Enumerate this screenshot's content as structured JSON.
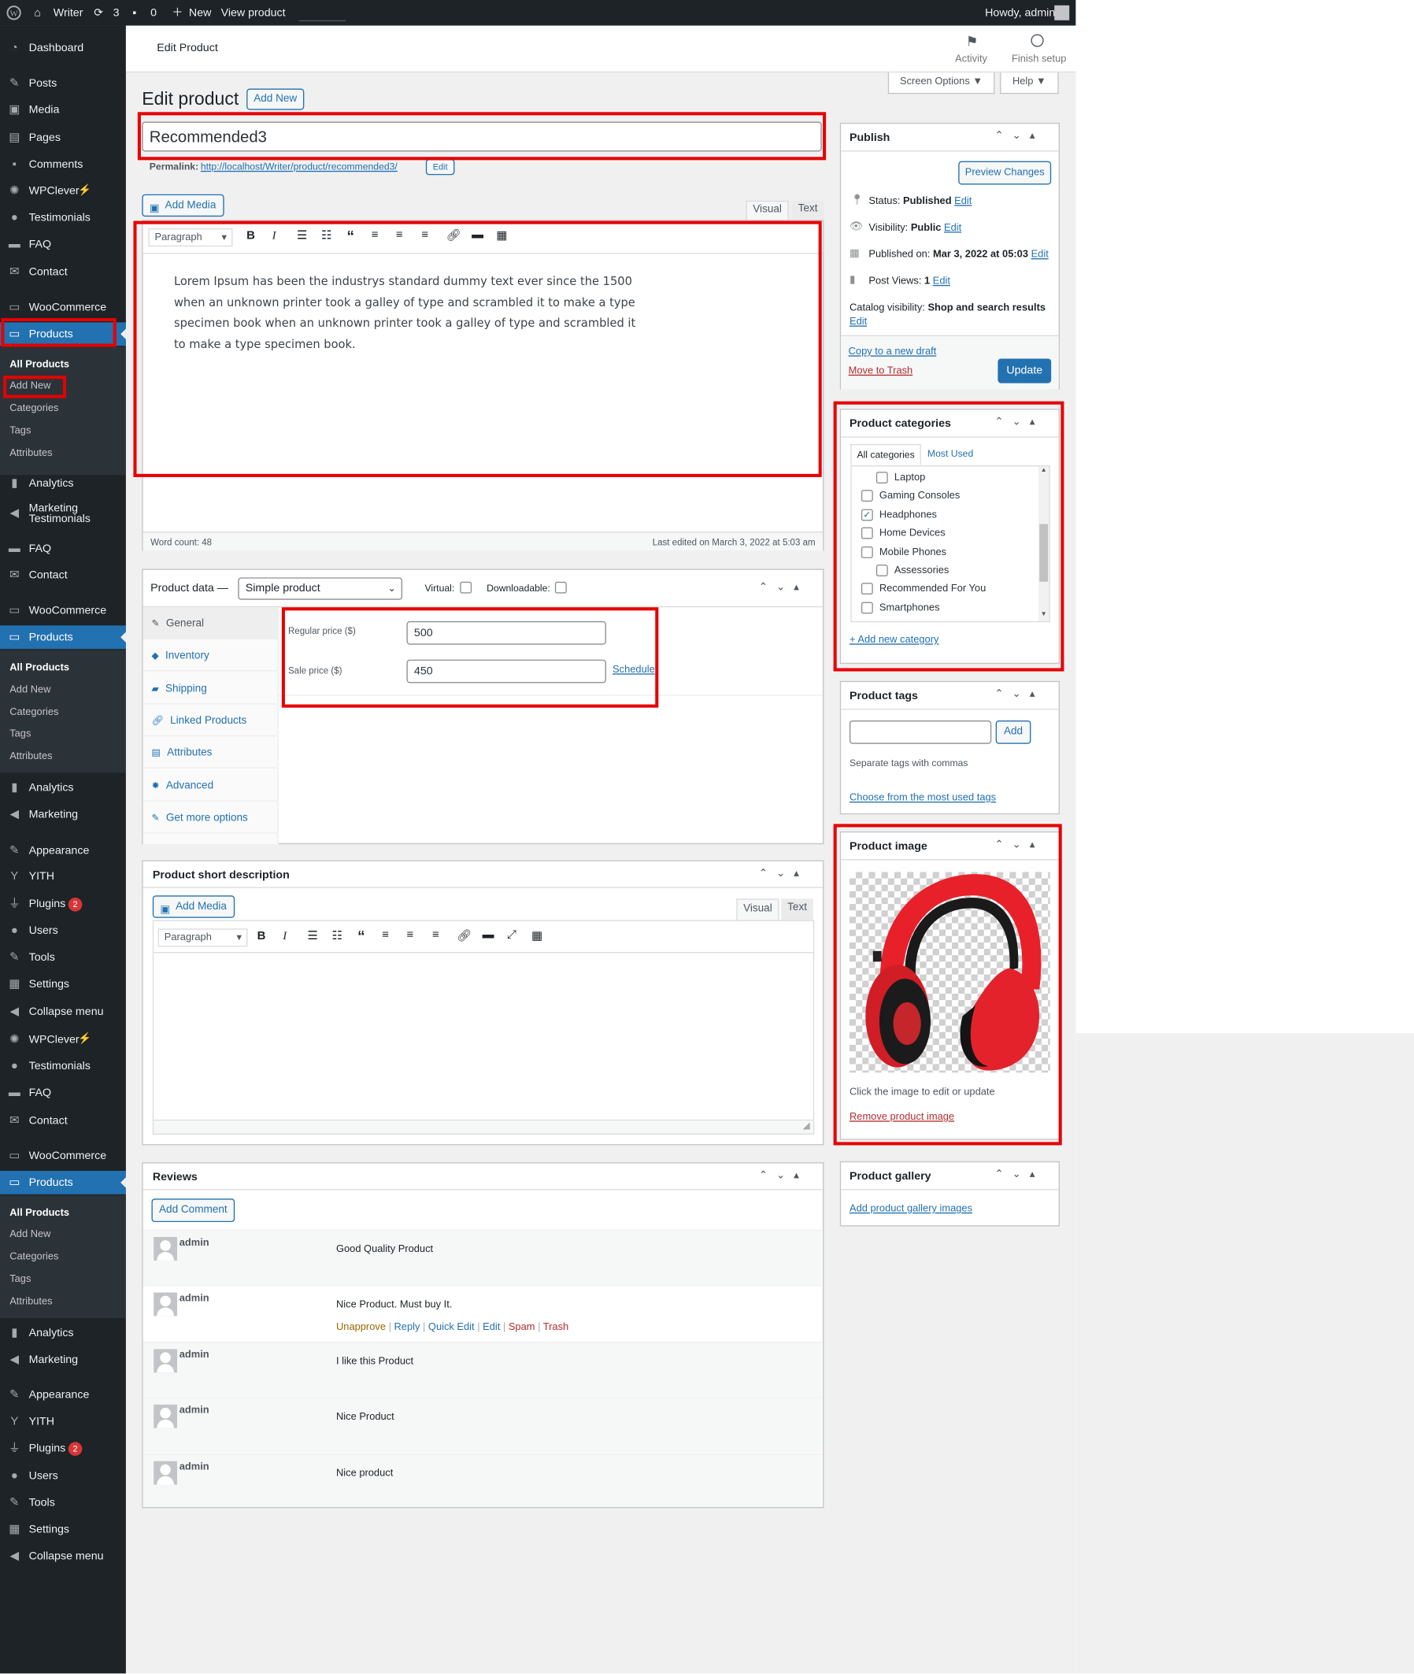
{
  "adminbar": {
    "site": "Writer",
    "updates": "3",
    "comments": "0",
    "new": "New",
    "view": "View product",
    "howdy": "Howdy, admin"
  },
  "colors": {
    "accent": "#2271b1",
    "sidebar": "#1d2327",
    "highlight": "#e60000"
  },
  "sidebar": {
    "top": [
      {
        "icon": "dashboard-icon",
        "label": "Dashboard"
      },
      {
        "icon": "pin-icon",
        "label": "Posts"
      },
      {
        "icon": "media-icon",
        "label": "Media"
      },
      {
        "icon": "pages-icon",
        "label": "Pages"
      },
      {
        "icon": "comment-icon",
        "label": "Comments"
      },
      {
        "icon": "bulb-icon",
        "label": "WPClever"
      },
      {
        "icon": "user-icon",
        "label": "Testimonials"
      },
      {
        "icon": "folder-icon",
        "label": "FAQ"
      },
      {
        "icon": "mail-icon",
        "label": "Contact"
      },
      {
        "icon": "woo-icon",
        "label": "WooCommerce"
      },
      {
        "icon": "box-icon",
        "label": "Products"
      }
    ],
    "sub1": [
      "All Products",
      "Add New",
      "Categories",
      "Tags",
      "Attributes"
    ],
    "mid": [
      {
        "icon": "chart-icon",
        "label": "Analytics"
      },
      {
        "icon": "megaphone-icon",
        "label": "Marketing Testimonials"
      },
      {
        "icon": "folder-icon",
        "label": "FAQ"
      },
      {
        "icon": "mail-icon",
        "label": "Contact"
      },
      {
        "icon": "woo-icon",
        "label": "WooCommerce"
      },
      {
        "icon": "box-icon",
        "label": "Products"
      }
    ],
    "sub2": [
      "All Products",
      "Add New",
      "Categories",
      "Tags",
      "Attributes"
    ],
    "mid2": [
      {
        "icon": "chart-icon",
        "label": "Analytics"
      },
      {
        "icon": "megaphone-icon",
        "label": "Marketing"
      },
      {
        "icon": "brush-icon",
        "label": "Appearance"
      },
      {
        "icon": "yith-icon",
        "label": "YITH"
      },
      {
        "icon": "plug-icon",
        "label": "Plugins",
        "badge": "2"
      },
      {
        "icon": "user-icon",
        "label": "Users"
      },
      {
        "icon": "wrench-icon",
        "label": "Tools"
      },
      {
        "icon": "settings-icon",
        "label": "Settings"
      },
      {
        "icon": "collapse-icon",
        "label": "Collapse menu"
      },
      {
        "icon": "bulb-icon",
        "label": "WPClever"
      },
      {
        "icon": "user-icon",
        "label": "Testimonials"
      },
      {
        "icon": "folder-icon",
        "label": "FAQ"
      },
      {
        "icon": "mail-icon",
        "label": "Contact"
      },
      {
        "icon": "woo-icon",
        "label": "WooCommerce"
      },
      {
        "icon": "box-icon",
        "label": "Products"
      }
    ],
    "sub3": [
      "All Products",
      "Add New",
      "Categories",
      "Tags",
      "Attributes"
    ],
    "bottom": [
      {
        "icon": "chart-icon",
        "label": "Analytics"
      },
      {
        "icon": "megaphone-icon",
        "label": "Marketing"
      },
      {
        "icon": "brush-icon",
        "label": "Appearance"
      },
      {
        "icon": "yith-icon",
        "label": "YITH"
      },
      {
        "icon": "plug-icon",
        "label": "Plugins",
        "badge": "2"
      },
      {
        "icon": "user-icon",
        "label": "Users"
      },
      {
        "icon": "wrench-icon",
        "label": "Tools"
      },
      {
        "icon": "settings-icon",
        "label": "Settings"
      },
      {
        "icon": "collapse-icon",
        "label": "Collapse menu"
      }
    ]
  },
  "header": {
    "title": "Edit Product",
    "activity": "Activity",
    "finish": "Finish setup",
    "screen_options": "Screen Options ▼",
    "help": "Help ▼"
  },
  "page": {
    "heading": "Edit product",
    "add_new": "Add New",
    "title_value": "Recommended3",
    "permalink_label": "Permalink:",
    "permalink_url": "http://localhost/Writer/product/recommended3/",
    "permalink_edit": "Edit"
  },
  "editor": {
    "add_media": "Add Media",
    "tab_visual": "Visual",
    "tab_text": "Text",
    "format": "Paragraph",
    "content": "Lorem Ipsum has been the industrys standard dummy text ever since the 1500 when an unknown printer took a galley of type and scrambled it to make a type specimen book when an unknown printer took a galley of type and scrambled it to make a type specimen book.",
    "word_count": "Word count: 48",
    "last_edited": "Last edited on March 3, 2022 at 5:03 am"
  },
  "product_data": {
    "label": "Product data —",
    "type": "Simple product",
    "virtual": "Virtual:",
    "downloadable": "Downloadable:",
    "tabs": [
      "General",
      "Inventory",
      "Shipping",
      "Linked Products",
      "Attributes",
      "Advanced",
      "Get more options"
    ],
    "regular_label": "Regular price ($)",
    "regular_value": "500",
    "sale_label": "Sale price ($)",
    "sale_value": "450",
    "schedule": "Schedule"
  },
  "short_desc": {
    "title": "Product short description",
    "add_media": "Add Media",
    "tab_visual": "Visual",
    "tab_text": "Text",
    "format": "Paragraph"
  },
  "reviews": {
    "title": "Reviews",
    "add_comment": "Add Comment",
    "items": [
      {
        "author": "admin",
        "text": "Good Quality Product"
      },
      {
        "author": "admin",
        "text": "Nice Product. Must buy It."
      },
      {
        "author": "admin",
        "text": "I like this Product"
      },
      {
        "author": "admin",
        "text": "Nice Product"
      },
      {
        "author": "admin",
        "text": "Nice product"
      }
    ],
    "actions": {
      "unapprove": "Unapprove",
      "reply": "Reply",
      "quick_edit": "Quick Edit",
      "edit": "Edit",
      "spam": "Spam",
      "trash": "Trash"
    }
  },
  "publish": {
    "title": "Publish",
    "preview": "Preview Changes",
    "status_label": "Status:",
    "status_value": "Published",
    "visibility_label": "Visibility:",
    "visibility_value": "Public",
    "published_label": "Published on:",
    "published_value": "Mar 3, 2022 at 05:03",
    "views_label": "Post Views:",
    "views_value": "1",
    "catalog_label": "Catalog visibility:",
    "catalog_value": "Shop and search results",
    "edit": "Edit",
    "copy": "Copy to a new draft",
    "trash": "Move to Trash",
    "update": "Update"
  },
  "categories": {
    "title": "Product categories",
    "tab_all": "All categories",
    "tab_used": "Most Used",
    "items": [
      {
        "label": "Laptop",
        "checked": false,
        "child": true
      },
      {
        "label": "Gaming Consoles",
        "checked": false,
        "child": false
      },
      {
        "label": "Headphones",
        "checked": true,
        "child": false
      },
      {
        "label": "Home Devices",
        "checked": false,
        "child": false
      },
      {
        "label": "Mobile Phones",
        "checked": false,
        "child": false
      },
      {
        "label": "Assessories",
        "checked": false,
        "child": true
      },
      {
        "label": "Recommended For You",
        "checked": false,
        "child": false
      },
      {
        "label": "Smartphones",
        "checked": false,
        "child": false
      }
    ],
    "add_new": "+ Add new category"
  },
  "tags": {
    "title": "Product tags",
    "add": "Add",
    "hint": "Separate tags with commas",
    "choose": "Choose from the most used tags"
  },
  "image": {
    "title": "Product image",
    "hint": "Click the image to edit or update",
    "remove": "Remove product image"
  },
  "gallery": {
    "title": "Product gallery",
    "add": "Add product gallery images"
  }
}
